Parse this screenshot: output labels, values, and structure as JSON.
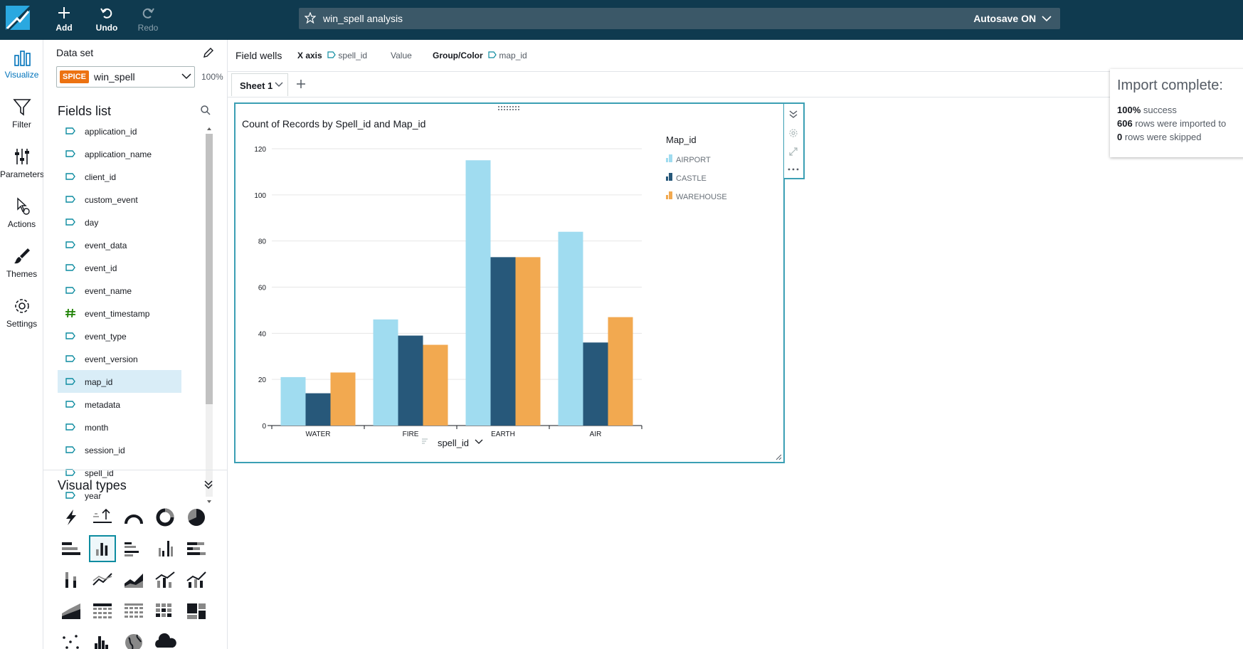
{
  "topbar": {
    "add_label": "Add",
    "undo_label": "Undo",
    "redo_label": "Redo",
    "analysis_title": "win_spell analysis",
    "autosave_label": "Autosave ON"
  },
  "nav": {
    "items": [
      {
        "label": "Visualize",
        "icon": "bar-chart-icon",
        "active": true
      },
      {
        "label": "Filter",
        "icon": "filter-icon"
      },
      {
        "label": "Parameters",
        "icon": "sliders-icon"
      },
      {
        "label": "Actions",
        "icon": "cursor-gear-icon"
      },
      {
        "label": "Themes",
        "icon": "brush-icon"
      },
      {
        "label": "Settings",
        "icon": "gear-icon"
      }
    ]
  },
  "dataset": {
    "label": "Data set",
    "badge": "SPICE",
    "name": "win_spell",
    "percent": "100%"
  },
  "fields_list": {
    "title": "Fields list",
    "items": [
      {
        "name": "application_id",
        "type": "dimension"
      },
      {
        "name": "application_name",
        "type": "dimension"
      },
      {
        "name": "client_id",
        "type": "dimension"
      },
      {
        "name": "custom_event",
        "type": "dimension"
      },
      {
        "name": "day",
        "type": "dimension"
      },
      {
        "name": "event_data",
        "type": "dimension"
      },
      {
        "name": "event_id",
        "type": "dimension"
      },
      {
        "name": "event_name",
        "type": "dimension"
      },
      {
        "name": "event_timestamp",
        "type": "measure"
      },
      {
        "name": "event_type",
        "type": "dimension"
      },
      {
        "name": "event_version",
        "type": "dimension"
      },
      {
        "name": "map_id",
        "type": "dimension",
        "selected": true
      },
      {
        "name": "metadata",
        "type": "dimension"
      },
      {
        "name": "month",
        "type": "dimension"
      },
      {
        "name": "session_id",
        "type": "dimension"
      },
      {
        "name": "spell_id",
        "type": "dimension"
      },
      {
        "name": "year",
        "type": "dimension"
      }
    ]
  },
  "visual_types": {
    "title": "Visual types"
  },
  "field_wells": {
    "label": "Field wells",
    "x_axis_label": "X axis",
    "x_axis_value": "spell_id",
    "value_label": "Value",
    "group_label": "Group/Color",
    "group_value": "map_id"
  },
  "sheet": {
    "tab_label": "Sheet 1"
  },
  "chart_data": {
    "type": "bar",
    "title": "Count of Records by Spell_id and Map_id",
    "xlabel": "spell_id",
    "ylabel": "",
    "categories": [
      "WATER",
      "FIRE",
      "EARTH",
      "AIR"
    ],
    "series": [
      {
        "name": "AIRPORT",
        "color": "#a0dcf0",
        "values": [
          21,
          46,
          115,
          84
        ]
      },
      {
        "name": "CASTLE",
        "color": "#27587a",
        "values": [
          14,
          39,
          73,
          36
        ]
      },
      {
        "name": "WAREHOUSE",
        "color": "#f2a950",
        "values": [
          23,
          35,
          73,
          47
        ]
      }
    ],
    "ylim": [
      0,
      120
    ],
    "yticks": [
      0,
      20,
      40,
      60,
      80,
      100,
      120
    ],
    "grid": true,
    "legend_title": "Map_id",
    "legend_position": "right"
  },
  "toast": {
    "title": "Import complete:",
    "line1_bold": "100%",
    "line1_text": " success",
    "line2_bold": "606",
    "line2_text": " rows were imported to",
    "line3_bold": "0",
    "line3_text": " rows were skipped"
  }
}
